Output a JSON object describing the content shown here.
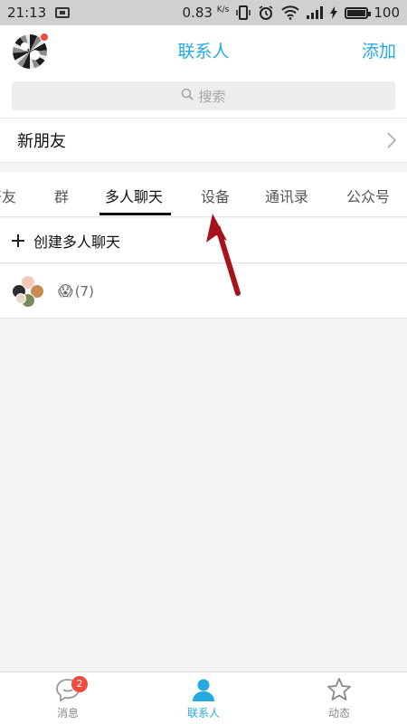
{
  "status_bar": {
    "time": "21:13",
    "speed": "0.83",
    "speed_unit": "K/s",
    "battery": "100"
  },
  "header": {
    "title": "联系人",
    "add_label": "添加"
  },
  "search": {
    "placeholder": "搜索"
  },
  "new_friends": {
    "label": "新朋友"
  },
  "tabs": [
    {
      "label": "好友"
    },
    {
      "label": "群"
    },
    {
      "label": "多人聊天",
      "active": true
    },
    {
      "label": "设备"
    },
    {
      "label": "通讯录"
    },
    {
      "label": "公众号"
    }
  ],
  "create_group": {
    "label": "创建多人聊天"
  },
  "group": {
    "emoji": "😱",
    "count": "(7)"
  },
  "bottom_nav": [
    {
      "label": "消息",
      "badge": "2"
    },
    {
      "label": "联系人",
      "active": true
    },
    {
      "label": "动态"
    }
  ],
  "colors": {
    "accent": "#26a9e0",
    "badge": "#f24a3c",
    "annotation": "#a5141c"
  }
}
